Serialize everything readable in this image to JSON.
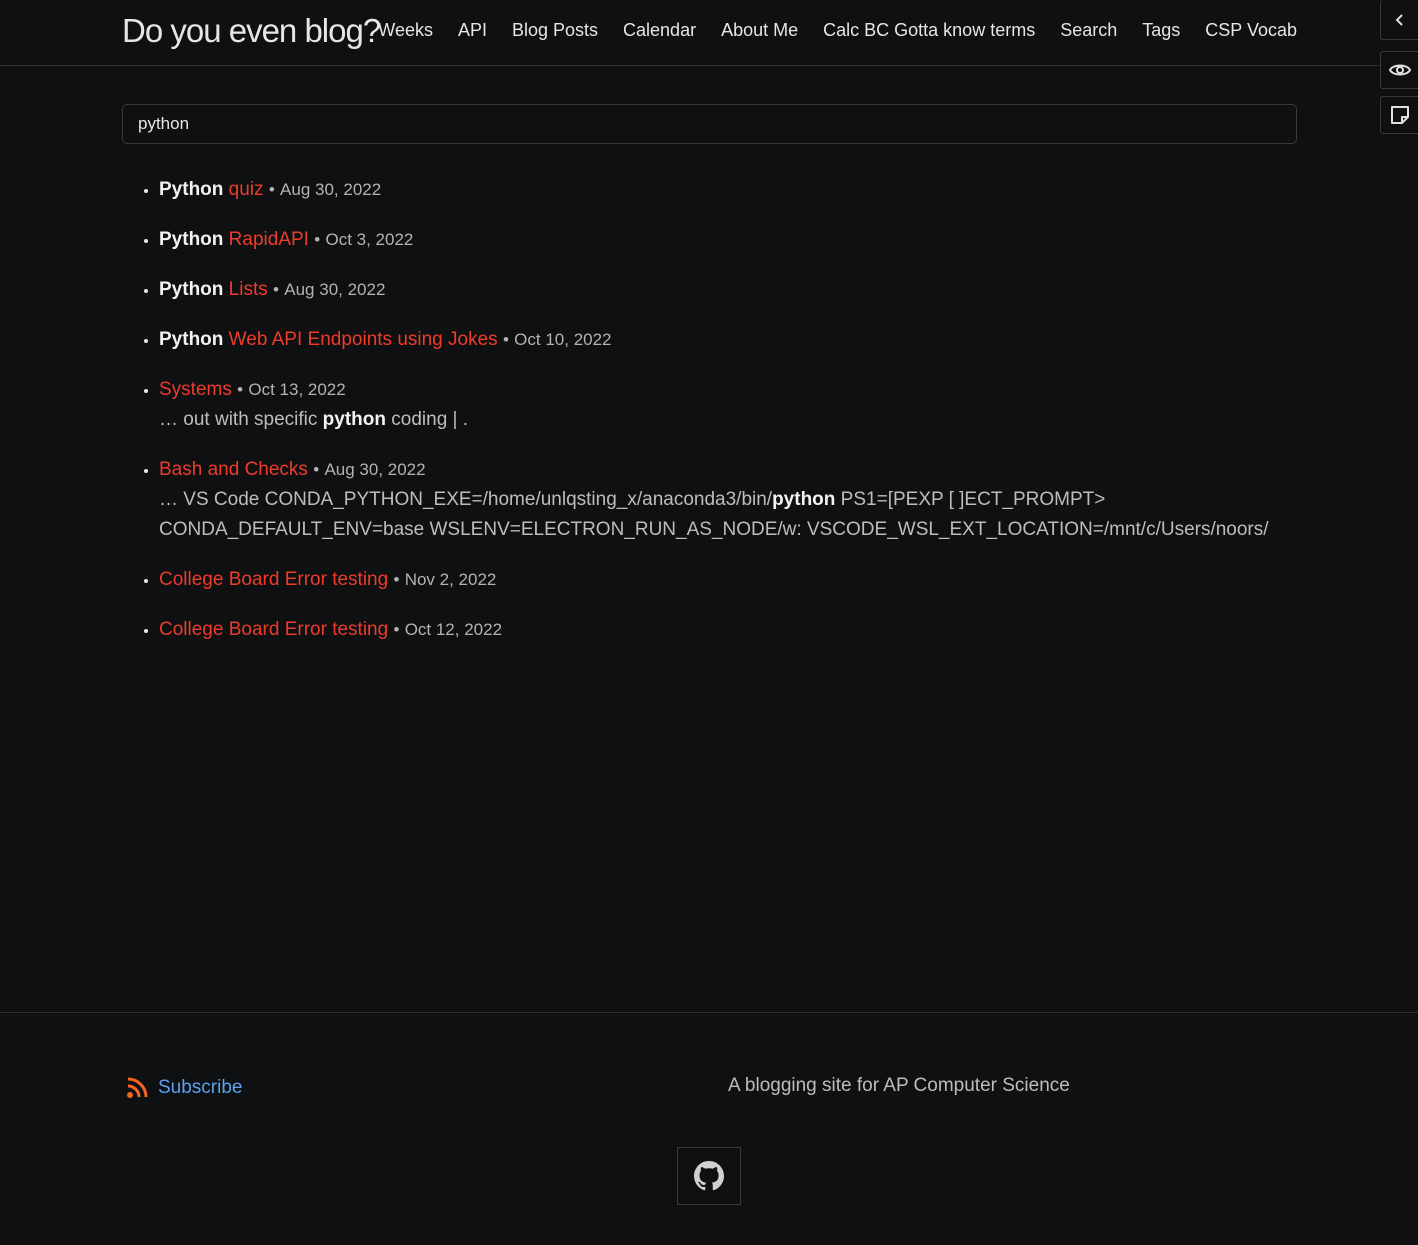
{
  "header": {
    "site_title": "Do you even blog?",
    "nav": [
      "Weeks",
      "API",
      "Blog Posts",
      "Calendar",
      "About Me",
      "Calc BC Gotta know terms",
      "Search",
      "Tags",
      "CSP Vocab"
    ]
  },
  "search": {
    "value": "python"
  },
  "results": [
    {
      "highlight": "Python",
      "title": "quiz",
      "date": "Aug 30, 2022",
      "excerpt_before": "",
      "excerpt_hl": "",
      "excerpt_after": ""
    },
    {
      "highlight": "Python",
      "title": "RapidAPI",
      "date": "Oct 3, 2022",
      "excerpt_before": "",
      "excerpt_hl": "",
      "excerpt_after": ""
    },
    {
      "highlight": "Python",
      "title": "Lists",
      "date": "Aug 30, 2022",
      "excerpt_before": "",
      "excerpt_hl": "",
      "excerpt_after": ""
    },
    {
      "highlight": "Python",
      "title": "Web API Endpoints using Jokes",
      "date": "Oct 10, 2022",
      "excerpt_before": "",
      "excerpt_hl": "",
      "excerpt_after": ""
    },
    {
      "highlight": "",
      "title": "Systems",
      "date": "Oct 13, 2022",
      "excerpt_before": "… out with specific ",
      "excerpt_hl": "python",
      "excerpt_after": " coding | ."
    },
    {
      "highlight": "",
      "title": "Bash and Checks",
      "date": "Aug 30, 2022",
      "excerpt_before": "… VS Code CONDA_PYTHON_EXE=/home/unlqsting_x/anaconda3/bin/",
      "excerpt_hl": "python",
      "excerpt_after": " PS1=[PEXP [ ]ECT_PROMPT> CONDA_DEFAULT_ENV=base WSLENV=ELECTRON_RUN_AS_NODE/w: VSCODE_WSL_EXT_LOCATION=/mnt/c/Users/noors/"
    },
    {
      "highlight": "",
      "title": "College Board Error testing",
      "date": "Nov 2, 2022",
      "excerpt_before": "",
      "excerpt_hl": "",
      "excerpt_after": ""
    },
    {
      "highlight": "",
      "title": "College Board Error testing",
      "date": "Oct 12, 2022",
      "excerpt_before": "",
      "excerpt_hl": "",
      "excerpt_after": ""
    }
  ],
  "footer": {
    "subscribe_label": "Subscribe",
    "tagline": "A blogging site for AP Computer Science"
  },
  "colors": {
    "background": "#0e1011",
    "link_red": "#ef3b2c",
    "subscribe_blue": "#5aa2f0",
    "rss_orange": "#f26522"
  }
}
